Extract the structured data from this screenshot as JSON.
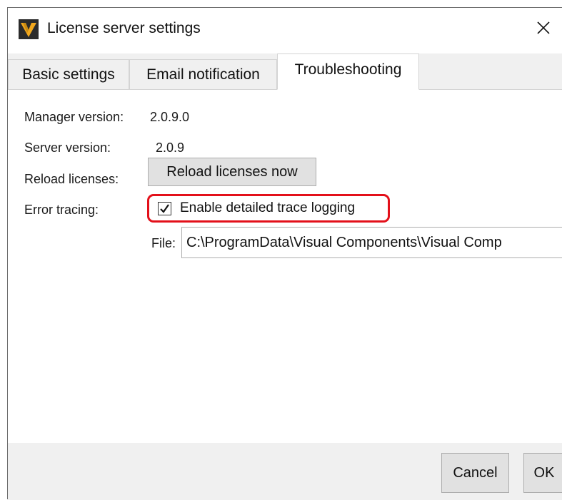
{
  "window": {
    "title": "License server settings",
    "close_glyph": "✕",
    "app_icon": "visual-components-logo-icon",
    "colors": {
      "logo_background": "#2b2b2b",
      "logo_accent": "#f2a81d",
      "highlight_border": "#e3101a",
      "tab_strip": "#f0f0f0",
      "button_face": "#e1e1e1"
    }
  },
  "tabs": [
    {
      "label": "Basic settings",
      "selected": false
    },
    {
      "label": "Email notification",
      "selected": false
    },
    {
      "label": "Troubleshooting",
      "selected": true
    }
  ],
  "troubleshooting": {
    "manager_version_label": "Manager version:",
    "manager_version_value": "2.0.9.0",
    "server_version_label": "Server version:",
    "server_version_value": "2.0.9",
    "reload_label": "Reload licenses:",
    "reload_button_label": "Reload licenses now",
    "error_tracing_label": "Error tracing:",
    "trace_checkbox_label": "Enable detailed trace logging",
    "trace_checkbox_checked": true,
    "file_label": "File:",
    "file_value": "C:\\ProgramData\\Visual Components\\Visual Comp"
  },
  "footer": {
    "cancel_label": "Cancel",
    "ok_label": "OK"
  }
}
